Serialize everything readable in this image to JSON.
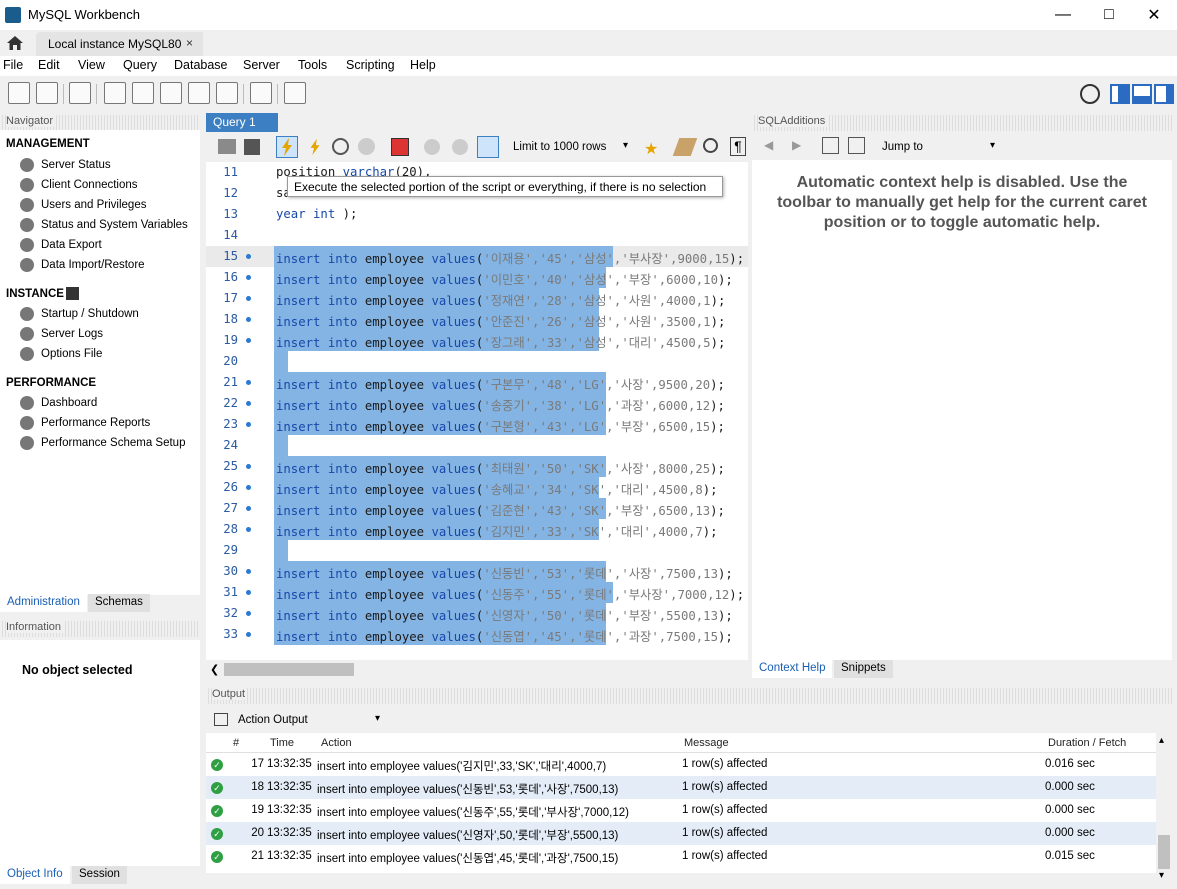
{
  "window": {
    "title": "MySQL Workbench"
  },
  "conn_tab": {
    "label": "Local instance MySQL80",
    "close": "×"
  },
  "menu": [
    "File",
    "Edit",
    "View",
    "Query",
    "Database",
    "Server",
    "Tools",
    "Scripting",
    "Help"
  ],
  "navigator": {
    "header": "Navigator",
    "management_title": "MANAGEMENT",
    "management": [
      "Server Status",
      "Client Connections",
      "Users and Privileges",
      "Status and System Variables",
      "Data Export",
      "Data Import/Restore"
    ],
    "instance_title": "INSTANCE",
    "instance": [
      "Startup / Shutdown",
      "Server Logs",
      "Options File"
    ],
    "performance_title": "PERFORMANCE",
    "performance": [
      "Dashboard",
      "Performance Reports",
      "Performance Schema Setup"
    ],
    "tabs": [
      "Administration",
      "Schemas"
    ]
  },
  "information": {
    "header": "Information",
    "empty": "No object selected",
    "tabs": [
      "Object Info",
      "Session"
    ]
  },
  "query_tab": {
    "label": "Query 1",
    "close": "×"
  },
  "limit_select": "Limit to 1000 rows",
  "tooltip": "Execute the selected portion of the script or everything, if there is no selection",
  "editor_lines": [
    {
      "n": "11",
      "pre": "position ",
      "kw": "varchar",
      "rest": "(20),",
      "sel": false,
      "dot": false
    },
    {
      "n": "12",
      "pre": "sa",
      "kw": "",
      "rest": "",
      "sel": false,
      "dot": false
    },
    {
      "n": "13",
      "pre": "",
      "kw": "year int",
      "rest": " );",
      "sel": false,
      "dot": false
    },
    {
      "n": "14",
      "pre": "",
      "kw": "",
      "rest": "",
      "sel": false,
      "dot": false
    },
    {
      "n": "15",
      "v": "'이재용','45','삼성','부사장',9000,15",
      "sel": true,
      "dot": true
    },
    {
      "n": "16",
      "v": "'이민호','40','삼성','부장',6000,10",
      "sel": true,
      "dot": true
    },
    {
      "n": "17",
      "v": "'정재연','28','삼성','사원',4000,1",
      "sel": true,
      "dot": true
    },
    {
      "n": "18",
      "v": "'안준진','26','삼성','사원',3500,1",
      "sel": true,
      "dot": true
    },
    {
      "n": "19",
      "v": "'장그래','33','삼성','대리',4500,5",
      "sel": true,
      "dot": true
    },
    {
      "n": "20",
      "blank": true,
      "sel": true,
      "dot": false
    },
    {
      "n": "21",
      "v": "'구본무','48','LG','사장',9500,20",
      "sel": true,
      "dot": true
    },
    {
      "n": "22",
      "v": "'송중기','38','LG','과장',6000,12",
      "sel": true,
      "dot": true
    },
    {
      "n": "23",
      "v": "'구본형','43','LG','부장',6500,15",
      "sel": true,
      "dot": true
    },
    {
      "n": "24",
      "blank": true,
      "sel": true,
      "dot": false
    },
    {
      "n": "25",
      "v": "'최태원','50','SK','사장',8000,25",
      "sel": true,
      "dot": true
    },
    {
      "n": "26",
      "v": "'송혜교','34','SK','대리',4500,8",
      "sel": true,
      "dot": true
    },
    {
      "n": "27",
      "v": "'김준현','43','SK','부장',6500,13",
      "sel": true,
      "dot": true
    },
    {
      "n": "28",
      "v": "'김지민','33','SK','대리',4000,7",
      "sel": true,
      "dot": true
    },
    {
      "n": "29",
      "blank": true,
      "sel": true,
      "dot": false
    },
    {
      "n": "30",
      "v": "'신동빈','53','롯데','사장',7500,13",
      "sel": true,
      "dot": true
    },
    {
      "n": "31",
      "v": "'신동주','55','롯데','부사장',7000,12",
      "sel": true,
      "dot": true
    },
    {
      "n": "32",
      "v": "'신영자','50','롯데','부장',5500,13",
      "sel": true,
      "dot": true
    },
    {
      "n": "33",
      "v": "'신동엽','45','롯데','과장',7500,15",
      "sel": true,
      "dot": true
    }
  ],
  "insert_prefix": "insert into employee values(",
  "insert_suffix": ");",
  "sql_additions": {
    "header": "SQLAdditions",
    "jump_to": "Jump to",
    "help_text": "Automatic context help is disabled. Use the toolbar to manually get help for the current caret position or to toggle automatic help.",
    "tabs": [
      "Context Help",
      "Snippets"
    ]
  },
  "output": {
    "header": "Output",
    "select": "Action Output",
    "columns": [
      "#",
      "Time",
      "Action",
      "Message",
      "Duration / Fetch"
    ],
    "rows": [
      {
        "n": "17",
        "time": "13:32:35",
        "action": "insert into employee values('김지민',33,'SK','대리',4000,7)",
        "msg": "1 row(s) affected",
        "dur": "0.016 sec"
      },
      {
        "n": "18",
        "time": "13:32:35",
        "action": "insert into employee values('신동빈',53,'롯데','사장',7500,13)",
        "msg": "1 row(s) affected",
        "dur": "0.000 sec"
      },
      {
        "n": "19",
        "time": "13:32:35",
        "action": "insert into employee values('신동주',55,'롯데','부사장',7000,12)",
        "msg": "1 row(s) affected",
        "dur": "0.000 sec"
      },
      {
        "n": "20",
        "time": "13:32:35",
        "action": "insert into employee values('신영자',50,'롯데','부장',5500,13)",
        "msg": "1 row(s) affected",
        "dur": "0.000 sec"
      },
      {
        "n": "21",
        "time": "13:32:35",
        "action": "insert into employee values('신동엽',45,'롯데','과장',7500,15)",
        "msg": "1 row(s) affected",
        "dur": "0.015 sec"
      }
    ]
  },
  "colors": {
    "accent": "#3c7fc2",
    "selection": "#84b4e4",
    "keyword": "#1749a8",
    "ok": "#2ea043"
  }
}
